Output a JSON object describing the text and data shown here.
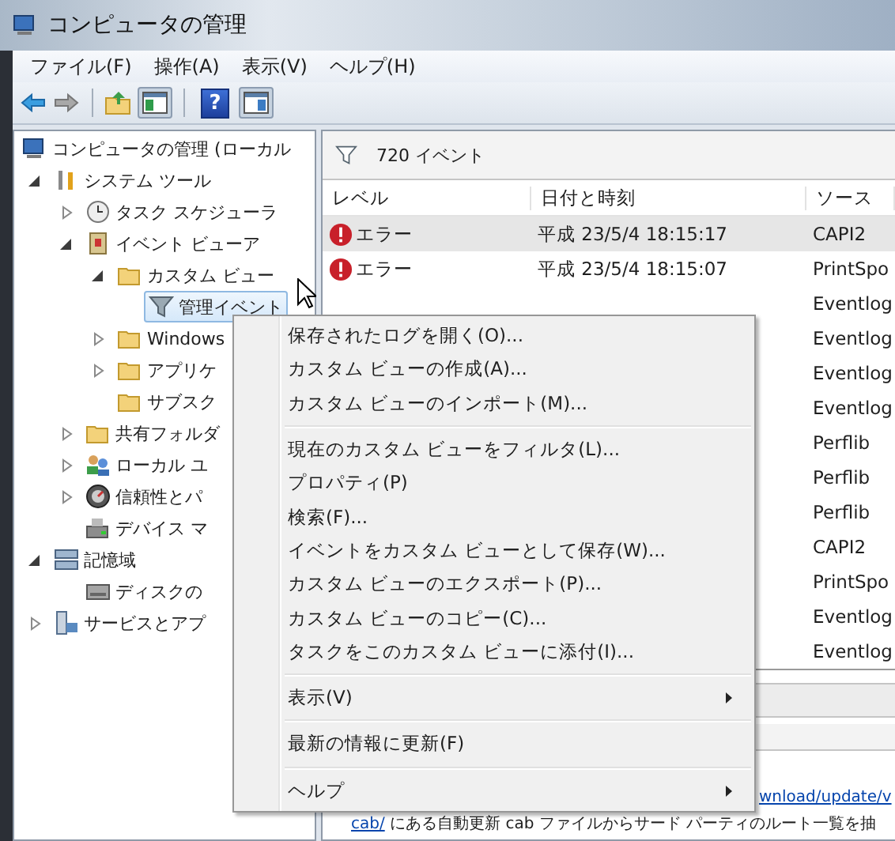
{
  "window": {
    "title": "コンピュータの管理"
  },
  "menu_bar": [
    "ファイル(F)",
    "操作(A)",
    "表示(V)",
    "ヘルプ(H)"
  ],
  "toolbar": [
    {
      "kind": "back"
    },
    {
      "kind": "forward"
    },
    {
      "kind": "separator"
    },
    {
      "kind": "up"
    },
    {
      "kind": "tree",
      "pressed": true
    },
    {
      "kind": "separator"
    },
    {
      "kind": "help",
      "glyph": "?"
    },
    {
      "kind": "action",
      "pressed": true
    }
  ],
  "tree": [
    {
      "label": "コンピュータの管理 (ローカル",
      "selected": false,
      "children": [
        {
          "label": "システム ツール",
          "expanded": true,
          "selected": false,
          "children": [
            {
              "label": "タスク スケジューラ",
              "expanded": false,
              "selected": false
            },
            {
              "label": "イベント ビューア",
              "expanded": true,
              "selected": false,
              "children": [
                {
                  "label": "カスタム ビュー",
                  "expanded": true,
                  "selected": false,
                  "children": [
                    {
                      "label": "管理イベント",
                      "selected": true
                    }
                  ]
                },
                {
                  "label": "Windows",
                  "expanded": false,
                  "selected": false
                },
                {
                  "label": "アプリケ",
                  "expanded": false,
                  "selected": false
                },
                {
                  "label": "サブスク",
                  "selected": false
                }
              ]
            },
            {
              "label": "共有フォルダ",
              "expanded": false,
              "selected": false
            },
            {
              "label": "ローカル ユ",
              "expanded": false,
              "selected": false
            },
            {
              "label": "信頼性とパ",
              "expanded": false,
              "selected": false
            },
            {
              "label": "デバイス マ",
              "selected": false
            }
          ]
        },
        {
          "label": "記憶域",
          "expanded": true,
          "selected": false,
          "children": [
            {
              "label": "ディスクの",
              "selected": false
            }
          ]
        },
        {
          "label": "サービスとアプ",
          "expanded": false,
          "selected": false
        }
      ]
    }
  ],
  "events": {
    "count_label": "720 イベント",
    "columns": [
      "レベル",
      "日付と時刻",
      "ソース"
    ],
    "rows": [
      {
        "kind": "error",
        "level": "エラー",
        "time": "平成 23/5/4 18:15:17",
        "source": "CAPI2",
        "selected": true
      },
      {
        "kind": "error",
        "level": "エラー",
        "time": "平成 23/5/4 18:15:07",
        "source": "PrintSpo",
        "selected": false
      },
      {
        "source": "Eventlog",
        "selected": false
      },
      {
        "source": "Eventlog",
        "selected": false
      },
      {
        "source": "Eventlog",
        "selected": false
      },
      {
        "source": "Eventlog",
        "selected": false
      },
      {
        "source": "Perflib",
        "selected": false
      },
      {
        "source": "Perflib",
        "selected": false
      },
      {
        "source": "Perflib",
        "selected": false
      },
      {
        "source": "CAPI2",
        "selected": false
      },
      {
        "source": "PrintSpo",
        "selected": false
      },
      {
        "source": "Eventlog",
        "selected": false
      },
      {
        "source": "Eventlog",
        "selected": false
      }
    ]
  },
  "details": {
    "link_1": "wnload/update/v",
    "link_2": "cab/",
    "text": "にある自動更新 cab ファイルからサード パーティのルート一覧を抽"
  },
  "context_menu": [
    {
      "kind": "item",
      "label": "保存されたログを開く(O)..."
    },
    {
      "kind": "item",
      "label": "カスタム ビューの作成(A)..."
    },
    {
      "kind": "item",
      "label": "カスタム ビューのインポート(M)..."
    },
    {
      "kind": "separator"
    },
    {
      "kind": "item",
      "label": "現在のカスタム ビューをフィルタ(L)..."
    },
    {
      "kind": "item",
      "label": "プロパティ(P)"
    },
    {
      "kind": "item",
      "label": "検索(F)..."
    },
    {
      "kind": "item",
      "label": "イベントをカスタム ビューとして保存(W)..."
    },
    {
      "kind": "item",
      "label": "カスタム ビューのエクスポート(P)..."
    },
    {
      "kind": "item",
      "label": "カスタム ビューのコピー(C)..."
    },
    {
      "kind": "item",
      "label": "タスクをこのカスタム ビューに添付(I)..."
    },
    {
      "kind": "separator"
    },
    {
      "kind": "submenu",
      "label": "表示(V)"
    },
    {
      "kind": "separator"
    },
    {
      "kind": "item",
      "label": "最新の情報に更新(F)"
    },
    {
      "kind": "separator"
    },
    {
      "kind": "submenu",
      "label": "ヘルプ"
    }
  ]
}
